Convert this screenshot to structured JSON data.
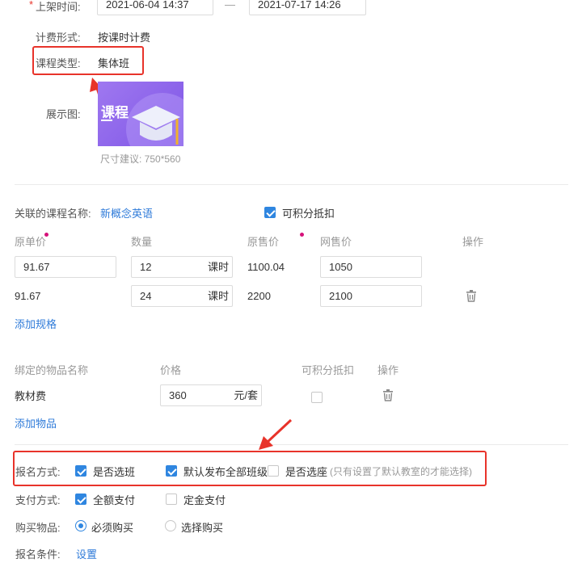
{
  "listing": {
    "label": "上架时间:",
    "start": "2021-06-04 14:37",
    "end": "2021-07-17 14:26",
    "separator": "—"
  },
  "billing": {
    "label": "计费形式:",
    "value": "按课时计费"
  },
  "course_type": {
    "label": "课程类型:",
    "value": "集体班"
  },
  "display_image": {
    "label": "展示图:",
    "thumb_text": "课程",
    "size_hint": "尺寸建议: 750*560"
  },
  "linked_course": {
    "label": "关联的课程名称:",
    "value": "新概念英语",
    "points_label": "可积分抵扣",
    "points_checked": true
  },
  "spec_table": {
    "headers": [
      "原单价",
      "数量",
      "原售价",
      "网售价",
      "操作"
    ],
    "rows": [
      {
        "unit_price": "91.67",
        "qty": "12",
        "unit": "课时",
        "orig_total": "1100.04",
        "net_price": "1050"
      },
      {
        "unit_price": "91.67",
        "qty": "24",
        "unit": "课时",
        "orig_total": "2200",
        "net_price": "2100"
      }
    ],
    "add_label": "添加规格"
  },
  "goods_table": {
    "headers": [
      "绑定的物品名称",
      "价格",
      "可积分抵扣",
      "操作"
    ],
    "rows": [
      {
        "name": "教材费",
        "price": "360",
        "unit": "元/套"
      }
    ],
    "add_label": "添加物品"
  },
  "signup": {
    "label": "报名方式:",
    "opt1": "是否选班",
    "opt2": "默认发布全部班级",
    "opt3": "是否选座",
    "note": "(只有设置了默认教室的才能选择)"
  },
  "payment": {
    "label": "支付方式:",
    "opt1": "全额支付",
    "opt2": "定金支付"
  },
  "purchase": {
    "label": "购买物品:",
    "opt1": "必须购买",
    "opt2": "选择购买"
  },
  "condition": {
    "label": "报名条件:",
    "link": "设置"
  },
  "colors": {
    "accent": "#2f86e0",
    "link": "#2f7bd9",
    "highlight": "#e8332a",
    "required_dot": "#d6127a"
  }
}
